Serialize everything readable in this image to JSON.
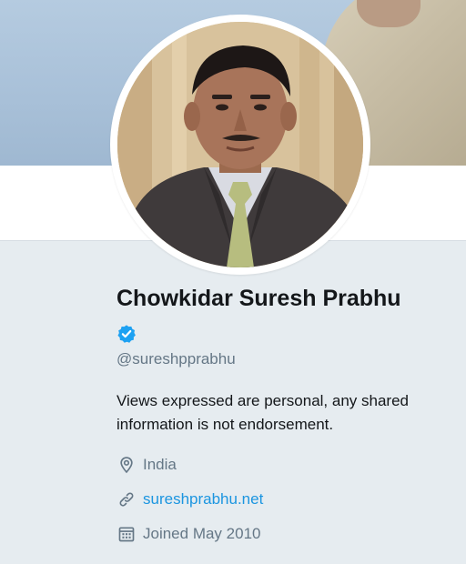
{
  "profile": {
    "name": "Chowkidar Suresh Prabhu",
    "handle": "@sureshpprabhu",
    "bio": "Views expressed are personal, any shared information is not endorsement.",
    "verified": true,
    "verified_icon": "verified-badge-icon",
    "location": "India",
    "location_icon": "location-pin-icon",
    "website": "sureshprabhu.net",
    "website_icon": "link-icon",
    "joined": "Joined May 2010",
    "joined_icon": "calendar-icon"
  },
  "colors": {
    "background": "#e6ecf0",
    "text_primary": "#14171a",
    "text_secondary": "#657786",
    "link": "#1b95e0",
    "verified_badge": "#1da1f2"
  }
}
